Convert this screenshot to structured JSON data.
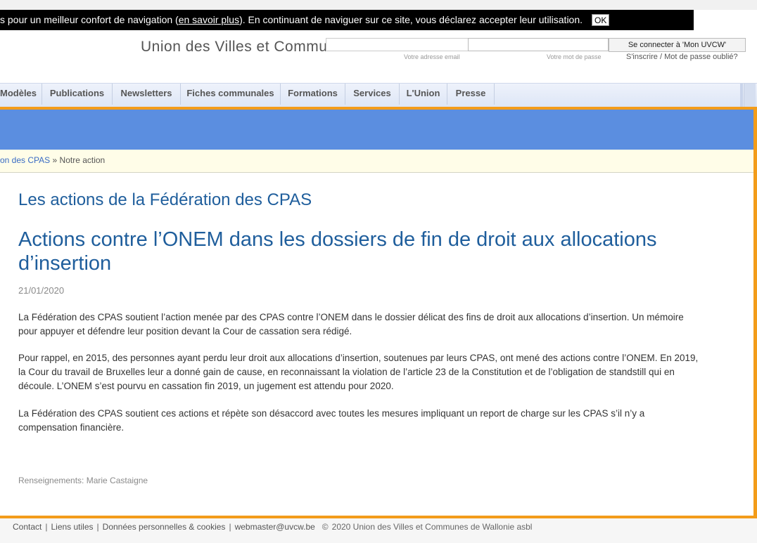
{
  "cookie_banner": {
    "text_before": "s pour un meilleur confort de navigation (",
    "link": "en savoir plus",
    "text_after": "). En continuant de naviguer sur ce site, vous déclarez accepter leur utilisation.",
    "ok_label": "OK"
  },
  "header": {
    "site_title": "Union des Villes et Communes de Wallonie asbl",
    "email_label": "Votre adresse email",
    "password_label": "Votre mot de passe",
    "login_button": "Se connecter à 'Mon UVCW'",
    "register_link": "S'inscrire",
    "link_separator": "/",
    "forgot_link": "Mot de passe oublié?"
  },
  "nav": {
    "items": [
      "Modèles",
      "Publications",
      "Newsletters",
      "Fiches communales",
      "Formations",
      "Services",
      "L'Union",
      "Presse"
    ]
  },
  "breadcrumb": {
    "parent": "on des CPAS",
    "separator": "»",
    "current": "Notre action"
  },
  "article": {
    "section_title": "Les actions de la Fédération des CPAS",
    "title": "Actions contre l’ONEM dans les dossiers de fin de droit aux allocations d’insertion",
    "date": "21/01/2020",
    "paragraphs": [
      "La Fédération des CPAS soutient l’action menée par des CPAS contre l’ONEM dans le dossier délicat des fins de droit aux allocations d’insertion. Un mémoire pour appuyer et défendre leur position devant la Cour de cassation sera rédigé.",
      "Pour rappel, en 2015, des personnes ayant perdu leur droit aux allocations d’insertion, soutenues par leurs CPAS, ont mené des actions contre l’ONEM.  En 2019, la Cour du travail de Bruxelles leur a donné gain de cause, en reconnaissant la violation de l’article 23 de la Constitution et de l’obligation de standstill qui en découle. L’ONEM s’est pourvu en cassation fin 2019, un jugement est attendu pour 2020.",
      "La Fédération des CPAS soutient ces actions et répète son désaccord avec toutes les mesures impliquant un report de charge sur les CPAS s’il n’y a compensation financière."
    ],
    "contact": "Renseignements: Marie Castaigne"
  },
  "footer": {
    "contact": "Contact",
    "liens": "Liens utiles",
    "donnees": "Données personnelles & cookies",
    "separator": "|",
    "email": "webmaster@uvcw.be",
    "copyright_symbol": "©",
    "copyright": "2020 Union des Villes et Communes de Wallonie asbl"
  },
  "colors": {
    "accent_orange": "#f39c1a",
    "band_blue": "#5b8ee0",
    "title_blue": "#1f5e9c"
  }
}
